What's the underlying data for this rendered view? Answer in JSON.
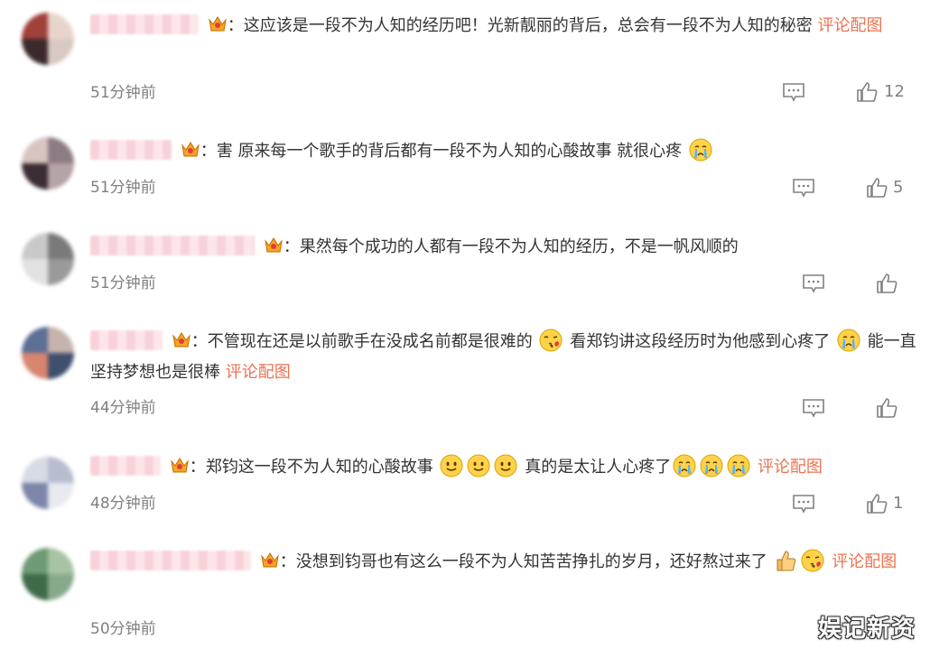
{
  "comments": [
    {
      "avatar_colors": [
        "#a0413a",
        "#e8d4cc",
        "#3b2a2a",
        "#d9c9c2"
      ],
      "text": "：这应该是一段不为人知的经历吧！光新靓丽的背后，总会有一段不为人知的秘密",
      "link": "评论配图",
      "emojis": [],
      "text_after": "",
      "link_after": "",
      "time": "51分钟前",
      "likes": "12"
    },
    {
      "avatar_colors": [
        "#d8c5c0",
        "#8e7c84",
        "#3a2d33",
        "#b5a3a6"
      ],
      "text": "：害 原来每一个歌手的背后都有一段不为人知的心酸故事 就很心疼",
      "link": "",
      "emojis": [
        "crying-emoji"
      ],
      "text_after": "",
      "link_after": "",
      "time": "51分钟前",
      "likes": "5"
    },
    {
      "avatar_colors": [
        "#c9c9c9",
        "#7a7a7a",
        "#e2e2e2",
        "#9a9a9a"
      ],
      "text": "：果然每个成功的人都有一段不为人知的经历，不是一帆风顺的",
      "link": "",
      "emojis": [],
      "text_after": "",
      "link_after": "",
      "time": "51分钟前",
      "likes": ""
    },
    {
      "avatar_colors": [
        "#5c6f95",
        "#c7b3ad",
        "#d88570",
        "#3f4f6e"
      ],
      "text": "：不管现在还是以前歌手在没成名前都是很难的",
      "link": "",
      "emojis": [
        "kiss-emoji"
      ],
      "text_after": "看郑钧讲这段经历时为他感到心疼了",
      "emojis_after": [
        "crying-emoji"
      ],
      "text_after2": "能一直坚持梦想也是很棒",
      "link_after": "评论配图",
      "time": "44分钟前",
      "likes": ""
    },
    {
      "avatar_colors": [
        "#d7dbe3",
        "#b7bdd0",
        "#7c86a8",
        "#e8eaef"
      ],
      "text": "：郑钧这一段不为人知的心酸故事",
      "link": "",
      "emojis": [
        "smile-emoji",
        "smile-emoji",
        "smile-emoji"
      ],
      "text_after": "真的是太让人心疼了",
      "emojis_after": [
        "crying-emoji",
        "crying-emoji",
        "crying-emoji"
      ],
      "text_after2": "",
      "link_after": "评论配图",
      "time": "48分钟前",
      "likes": "1"
    },
    {
      "avatar_colors": [
        "#6f9a76",
        "#a7c3a4",
        "#3f6b48",
        "#88aa8b"
      ],
      "text": "：没想到钧哥也有这么一段不为人知苦苦挣扎的岁月，还好熬过来了",
      "link": "",
      "emojis": [
        "thumbs-up-emoji",
        "kiss-emoji"
      ],
      "text_after": "",
      "link_after": "评论配图",
      "time": "50分钟前",
      "likes": ""
    }
  ],
  "watermark": "娱记新资",
  "colors": {
    "link": "#eb7350",
    "meta": "#808080",
    "text": "#333333"
  }
}
